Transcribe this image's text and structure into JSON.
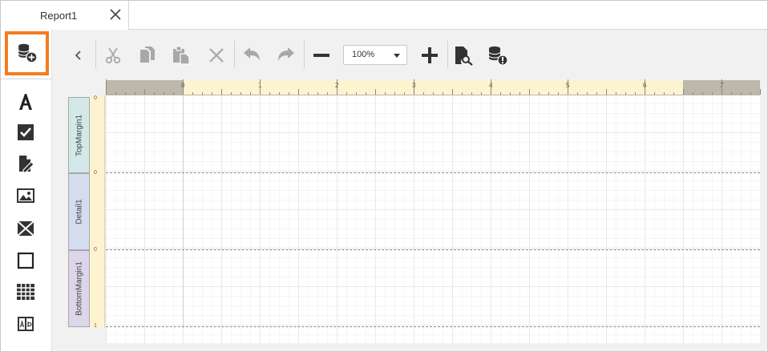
{
  "tab": {
    "title": "Report1"
  },
  "toolbar": {
    "zoom_value": "100%"
  },
  "ruler": {
    "numbers": [
      "0",
      "1",
      "2",
      "3",
      "4",
      "5",
      "6",
      "7"
    ]
  },
  "vertical_ruler": {
    "numbers": [
      "0",
      "0",
      "0",
      "1"
    ]
  },
  "bands": [
    {
      "name": "TopMargin1",
      "color": "#d3e8e8"
    },
    {
      "name": "Detail1",
      "color": "#d3ddef"
    },
    {
      "name": "BottomMargin1",
      "color": "#ddd5ea"
    }
  ],
  "colors": {
    "highlight": "#f47c20",
    "icon": "#333333",
    "icon_disabled": "#a8a8a8"
  }
}
